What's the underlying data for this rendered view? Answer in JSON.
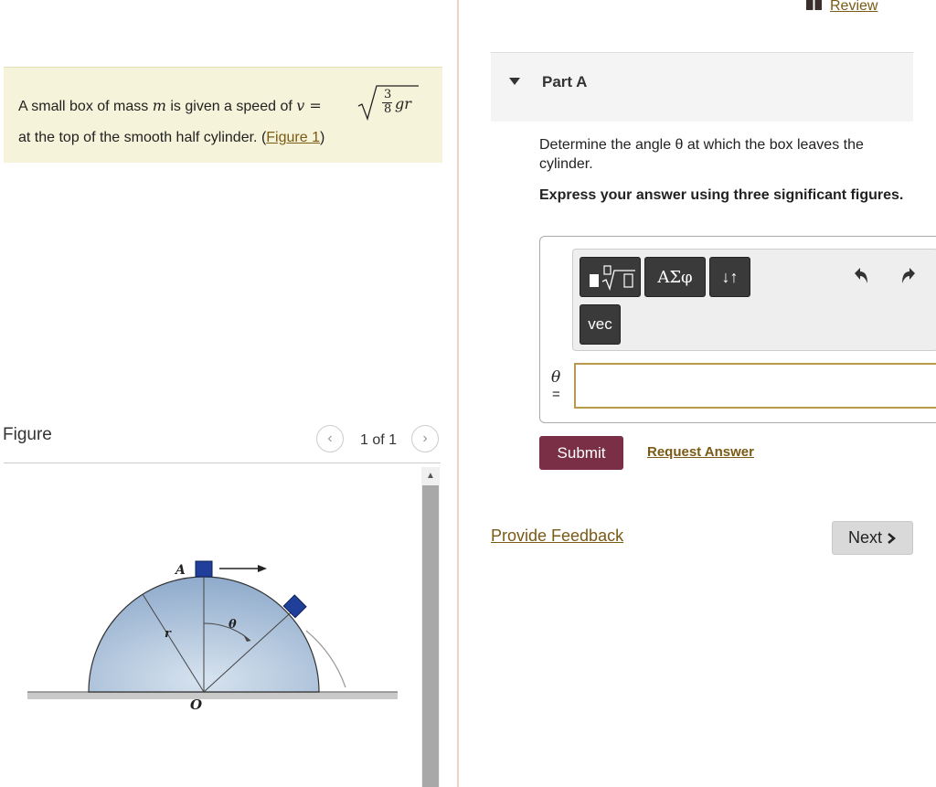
{
  "problem": {
    "text_before": "A small box of mass",
    "mass_symbol": "m",
    "text_mid": "is given a speed of",
    "speed_expr": "v =",
    "frac_num": "3",
    "frac_den": "8",
    "sqrt_rest": "gr",
    "line2_before": "at the top of the smooth half cylinder. (",
    "figure_link": "Figure 1",
    "line2_after": ")"
  },
  "figure_panel": {
    "title": "Figure",
    "prev_icon": "chevron-left-icon",
    "next_icon": "chevron-right-icon",
    "pager": "1 of 1",
    "labels": {
      "point": "A",
      "radius": "r",
      "angle": "θ",
      "origin": "O"
    }
  },
  "review": {
    "label": "Review",
    "icon": "book-icon"
  },
  "part": {
    "title": "Part A",
    "caret_icon": "caret-down-icon"
  },
  "question": "Determine the angle θ at which the box leaves the cylinder.",
  "instruction": "Express your answer using three significant figures.",
  "toolbar": {
    "templates_icon": "templates-icon",
    "symbols_label": "ΑΣφ",
    "arrows_label": "↓↑",
    "vec_label": "vec",
    "undo_icon": "undo-icon",
    "redo_icon": "redo-icon"
  },
  "answer": {
    "variable": "θ",
    "equals": "=",
    "value": ""
  },
  "buttons": {
    "submit": "Submit",
    "request_answer": "Request Answer",
    "provide_feedback": "Provide Feedback",
    "next": "Next"
  },
  "colors": {
    "problem_bg": "#f5f3d9",
    "link": "#7a5a14",
    "submit_bg": "#7a2f46",
    "toolbar_btn": "#3a3a3a",
    "input_border": "#b89a4a",
    "cylinder": "#a9c0d8",
    "box": "#1f3f9a"
  }
}
